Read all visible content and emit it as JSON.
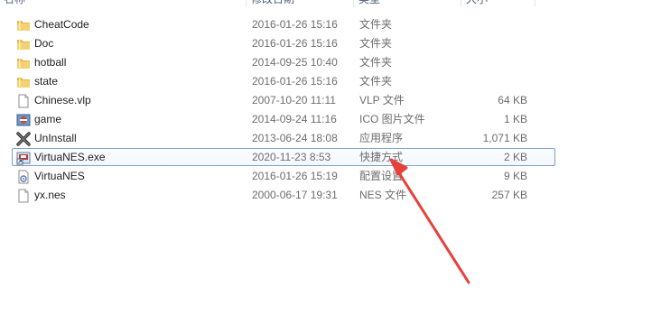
{
  "header": {
    "name": "名称",
    "date": "修改日期",
    "type": "类型",
    "size": "大小"
  },
  "files": [
    {
      "name": "CheatCode",
      "date": "2016-01-26 15:16",
      "type": "文件夹",
      "size": "",
      "icon": "folder-icon"
    },
    {
      "name": "Doc",
      "date": "2016-01-26 15:16",
      "type": "文件夹",
      "size": "",
      "icon": "folder-icon"
    },
    {
      "name": "hotball",
      "date": "2014-09-25 10:40",
      "type": "文件夹",
      "size": "",
      "icon": "folder-icon"
    },
    {
      "name": "state",
      "date": "2016-01-26 15:16",
      "type": "文件夹",
      "size": "",
      "icon": "folder-icon"
    },
    {
      "name": "Chinese.vlp",
      "date": "2007-10-20 11:11",
      "type": "VLP 文件",
      "size": "64 KB",
      "icon": "document-icon"
    },
    {
      "name": "game",
      "date": "2014-09-24 11:16",
      "type": "ICO 图片文件",
      "size": "1 KB",
      "icon": "image-icon"
    },
    {
      "name": "UnInstall",
      "date": "2013-06-24 18:08",
      "type": "应用程序",
      "size": "1,071 KB",
      "icon": "uninstall-icon"
    },
    {
      "name": "VirtuaNES.exe",
      "date": "2020-11-23 8:53",
      "type": "快捷方式",
      "size": "2 KB",
      "icon": "shortcut-icon",
      "selected": true
    },
    {
      "name": "VirtuaNES",
      "date": "2016-01-26 15:19",
      "type": "配置设置",
      "size": "9 KB",
      "icon": "settings-file-icon"
    },
    {
      "name": "yx.nes",
      "date": "2000-06-17 19:31",
      "type": "NES 文件",
      "size": "257 KB",
      "icon": "document-icon"
    }
  ],
  "colors": {
    "arrow": "#e8403a",
    "selection_border": "#7da2ce",
    "folder": "#e8c15a"
  }
}
